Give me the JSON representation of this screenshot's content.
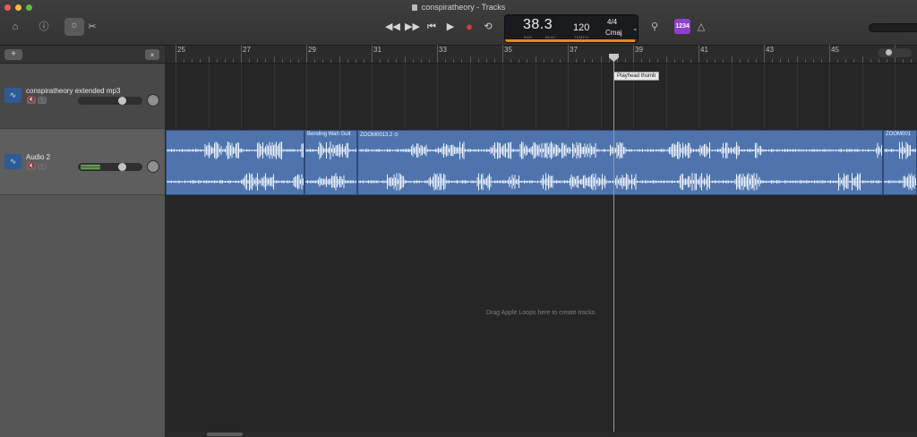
{
  "window": {
    "title": "conspiratheory - Tracks"
  },
  "toolbar": {
    "library_icon": "library-icon",
    "help_icon": "help-icon",
    "smart_controls_icon": "smart-controls-icon",
    "scissors_icon": "scissors-icon",
    "tuner_icon": "tuner-icon",
    "metronome_icon": "metronome-icon",
    "count_in_label": "1234"
  },
  "transport": {
    "rewind": "◀◀",
    "forward": "▶▶",
    "to_start": "⏮",
    "play": "▶",
    "record": "●",
    "cycle": "⟲"
  },
  "lcd": {
    "bar_beat": "38.3",
    "bar_label": "BAR",
    "beat_label": "BEAT",
    "tempo": "120",
    "tempo_label": "TEMPO",
    "time_signature": "4/4",
    "key": "Cmaj",
    "progress": 0.98
  },
  "ruler": {
    "bars": [
      "25",
      "27",
      "29",
      "31",
      "33",
      "35",
      "37",
      "39",
      "41",
      "43",
      "45"
    ]
  },
  "playhead": {
    "tooltip": "Playhead thumb"
  },
  "tracks": [
    {
      "name": "conspiratheory extended mp3",
      "mute_icon": "🔇",
      "solo_icon": "🎧",
      "volume": 0.72
    },
    {
      "name": "Audio 2",
      "mute_icon": "🔇",
      "solo_icon": "🎧",
      "volume": 0.72
    }
  ],
  "regions": [
    {
      "name": ""
    },
    {
      "name": "Bending Wah Guit"
    },
    {
      "name": "ZOOM0013.2"
    },
    {
      "name": "ZOOM001"
    }
  ],
  "drop_hint": "Drag Apple Loops here to create tracks.",
  "colors": {
    "region": "#4f74ad",
    "record": "#e03a34",
    "lcd_accent": "#e28a2c",
    "count_in": "#8f3fd1"
  }
}
